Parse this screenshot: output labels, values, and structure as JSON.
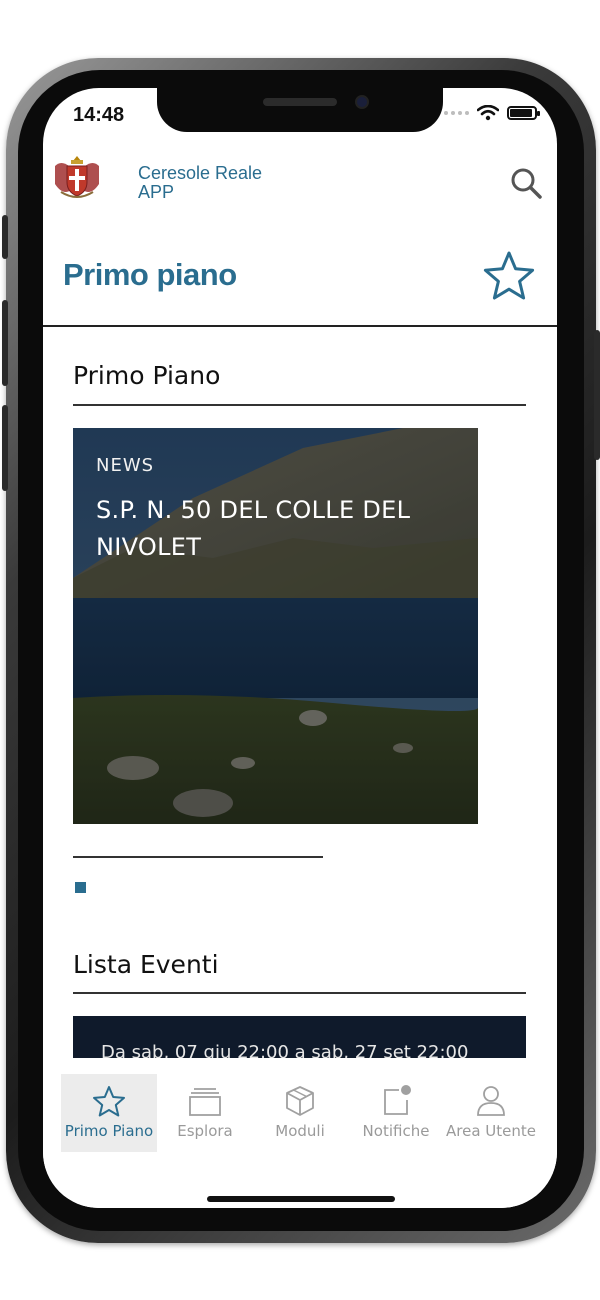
{
  "status_bar": {
    "time": "14:48"
  },
  "header": {
    "brand_line1": "Ceresole Reale",
    "brand_line2": "APP"
  },
  "page": {
    "title": "Primo piano"
  },
  "sections": {
    "featured_title": "Primo Piano",
    "events_title": "Lista Eventi"
  },
  "featured_card": {
    "kicker": "NEWS",
    "headline": "S.P. N. 50 DEL COLLE DEL NIVOLET"
  },
  "event_card": {
    "date_text": "Da sab, 07 giu 22:00 a sab, 27 set 22:00"
  },
  "tabs": [
    {
      "label": "Primo Piano",
      "icon": "star-icon",
      "active": true
    },
    {
      "label": "Esplora",
      "icon": "layers-icon",
      "active": false
    },
    {
      "label": "Moduli",
      "icon": "cube-icon",
      "active": false
    },
    {
      "label": "Notifiche",
      "icon": "notification-icon",
      "active": false
    },
    {
      "label": "Area Utente",
      "icon": "user-icon",
      "active": false
    }
  ],
  "colors": {
    "accent": "#2a6d8f",
    "tab_inactive": "#9a9a9a",
    "tab_active_bg": "#ececec"
  }
}
